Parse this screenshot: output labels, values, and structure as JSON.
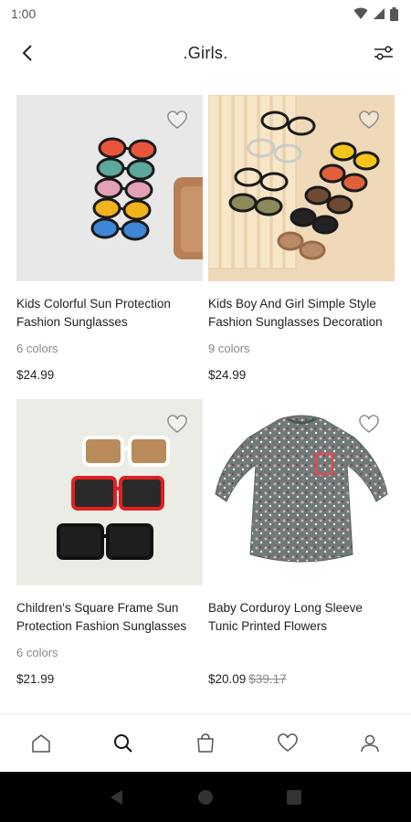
{
  "status_bar": {
    "time": "1:00",
    "icons": [
      "wifi-icon",
      "signal-icon",
      "battery-icon"
    ]
  },
  "header": {
    "title": ".Girls.",
    "back_icon": "back-arrow-icon",
    "filter_icon": "filter-sliders-icon"
  },
  "products": [
    {
      "name": "Kids Colorful Sun Protection Fashion Sunglasses",
      "colors": "6 colors",
      "price": "$24.99",
      "old_price": "",
      "favorite_icon": "heart-outline-icon"
    },
    {
      "name": "Kids Boy And Girl Simple Style Fashion Sunglasses Decoration",
      "colors": "9 colors",
      "price": "$24.99",
      "old_price": "",
      "favorite_icon": "heart-outline-icon"
    },
    {
      "name": "Children's Square Frame Sun Protection Fashion Sunglasses",
      "colors": "6 colors",
      "price": "$21.99",
      "old_price": "",
      "favorite_icon": "heart-outline-icon"
    },
    {
      "name": "Baby Corduroy Long Sleeve Tunic Printed Flowers",
      "colors": "",
      "price": "$20.09",
      "old_price": "$39.17",
      "favorite_icon": "heart-outline-icon"
    }
  ],
  "bottom_nav": {
    "items": [
      "home-icon",
      "search-icon",
      "bag-icon",
      "heart-icon",
      "profile-icon"
    ],
    "active": "search-icon"
  },
  "system_nav": {
    "items": [
      "back-triangle-icon",
      "home-circle-icon",
      "recents-square-icon"
    ]
  },
  "colors": {
    "accent": "#222222",
    "muted": "#888888",
    "divider": "#eeeeee"
  }
}
